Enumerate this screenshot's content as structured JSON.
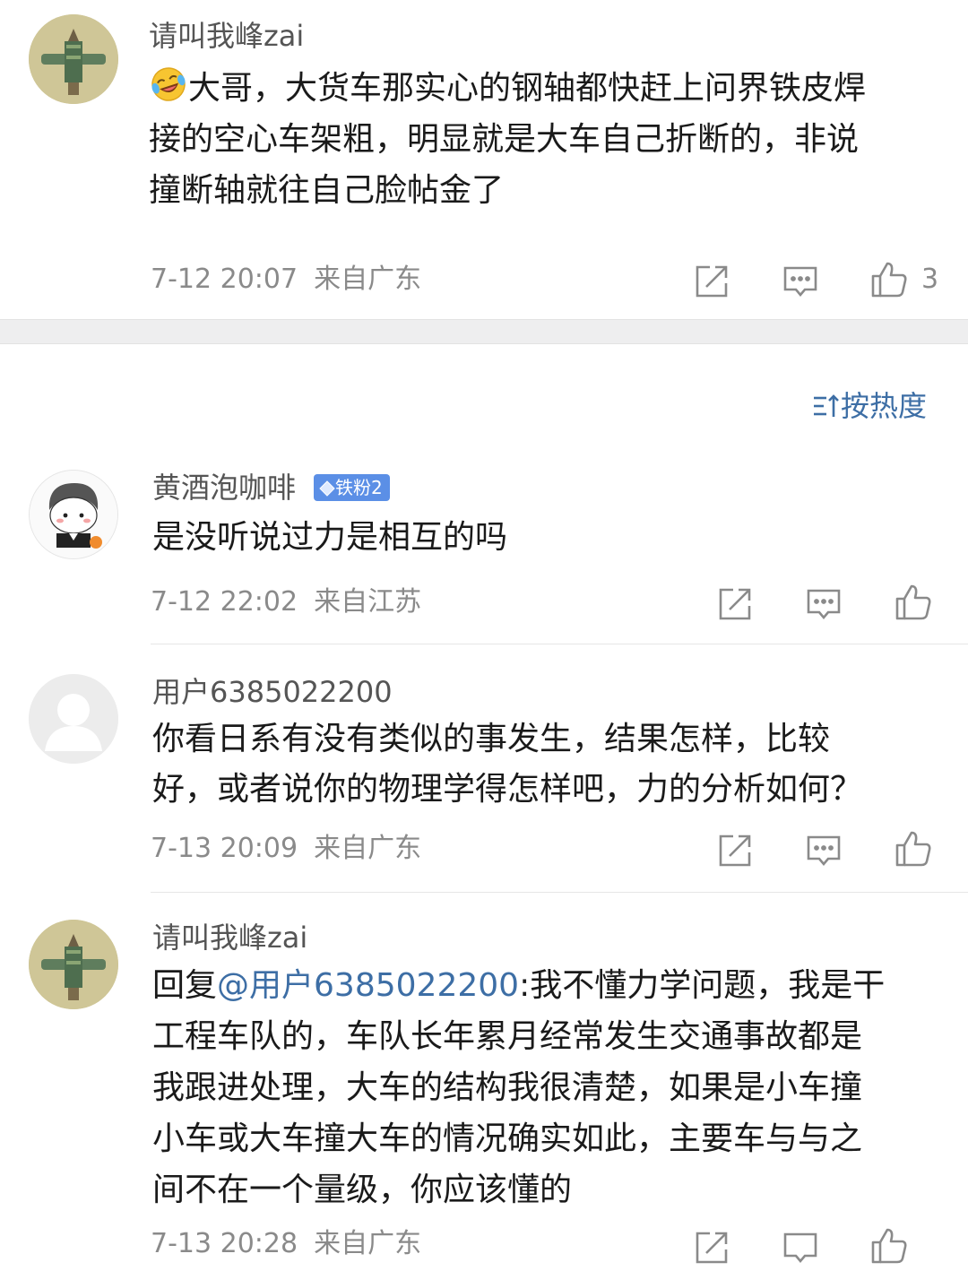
{
  "comments": [
    {
      "username": "请叫我峰zai",
      "text_lines": [
        "大哥，大货车那实心的钢轴都快赶上问界铁皮焊",
        "接的空心车架粗，明显就是大车自己折断的，非说",
        "撞断轴就往自己脸帖金了"
      ],
      "emoji": "laugh-cry-emoji",
      "time": "7-12 20:07",
      "location": "来自广东",
      "likes": "3"
    },
    {
      "username": "黄酒泡咖啡",
      "badge": "铁粉2",
      "text_lines": [
        "是没听说过力是相互的吗"
      ],
      "time": "7-12 22:02",
      "location": "来自江苏",
      "likes": ""
    },
    {
      "username": "用户6385022200",
      "text_lines": [
        "你看日系有没有类似的事发生，结果怎样，比较",
        "好，或者说你的物理学得怎样吧，力的分析如何？"
      ],
      "time": "7-13 20:09",
      "location": "来自广东",
      "likes": ""
    },
    {
      "username": "请叫我峰zai",
      "reply_prefix": "回复",
      "reply_mention": "@用户6385022200",
      "reply_first_rest": ":我不懂力学问题，我是干",
      "text_lines": [
        "工程车队的，车队长年累月经常发生交通事故都是",
        "我跟进处理，大车的结构我很清楚，如果是小车撞",
        "小车或大车撞大车的情况确实如此，主要车与与之",
        "间不在一个量级，你应该懂的"
      ],
      "time": "7-13 20:28",
      "location": "来自广东"
    }
  ],
  "sort_label": "按热度",
  "icons": {
    "share": "share-icon",
    "comment": "comment-icon",
    "like": "thumbs-up-icon",
    "sort": "sort-icon"
  },
  "colors": {
    "link": "#3d6ea5",
    "badge": "#5b8fe6",
    "meta": "#8a8a8a"
  }
}
